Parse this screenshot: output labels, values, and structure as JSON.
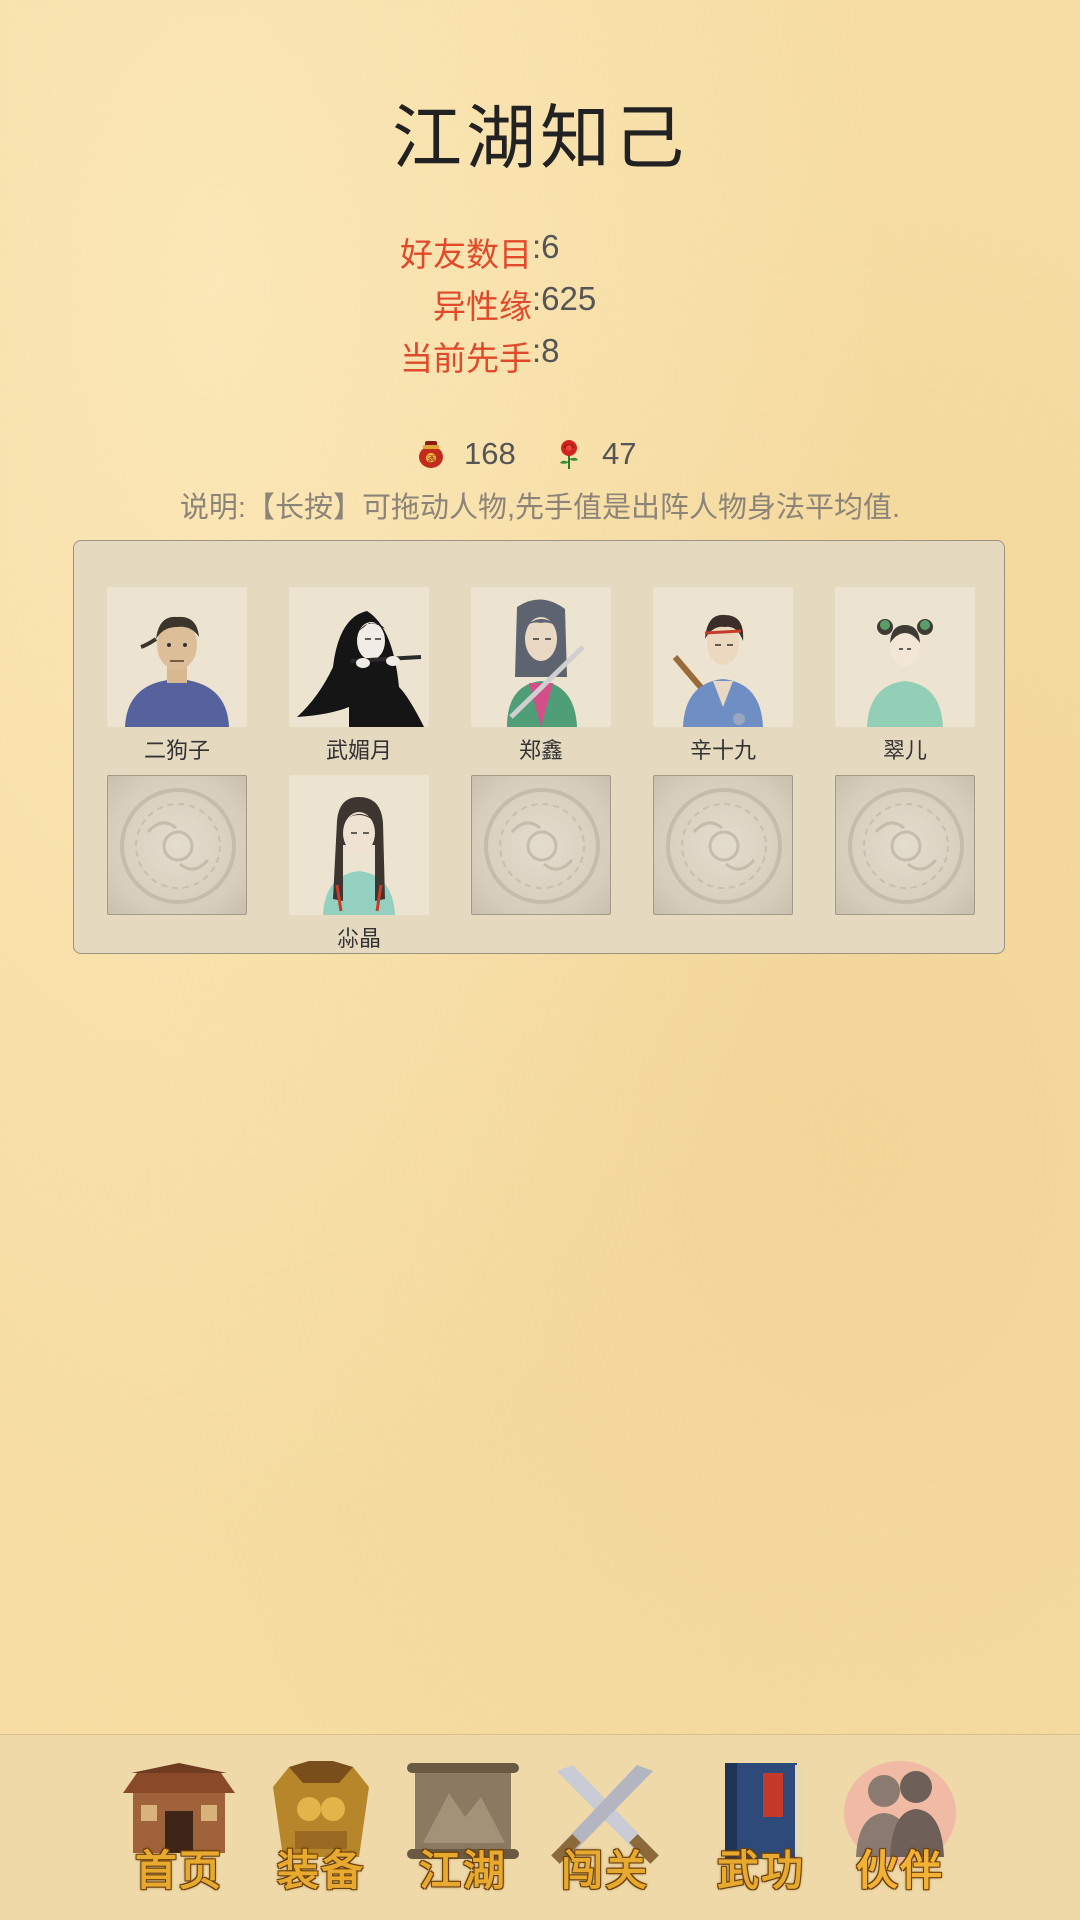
{
  "page": {
    "title": "江湖知己"
  },
  "stats": [
    {
      "label": "好友数目",
      "value": ":6"
    },
    {
      "label": "异性缘",
      "value": ":625"
    },
    {
      "label": "当前先手",
      "value": ":8"
    }
  ],
  "currency": [
    {
      "icon": "wine-jar-icon",
      "value": "168"
    },
    {
      "icon": "rose-icon",
      "value": "47"
    }
  ],
  "note": "说明:【长按】可拖动人物,先手值是出阵人物身法平均值.",
  "party": {
    "row1": [
      {
        "name": "二狗子",
        "portrait": "man-blue-robe"
      },
      {
        "name": "武媚月",
        "portrait": "woman-black-flute"
      },
      {
        "name": "郑鑫",
        "portrait": "swordsman-green-robe"
      },
      {
        "name": "辛十九",
        "portrait": "youth-blue-staff"
      },
      {
        "name": "翠儿",
        "portrait": "girl-teal-dress"
      }
    ],
    "row2": [
      {
        "name": "",
        "portrait": "empty"
      },
      {
        "name": "尛晶",
        "portrait": "woman-braids-teal"
      },
      {
        "name": "",
        "portrait": "empty"
      },
      {
        "name": "",
        "portrait": "empty"
      },
      {
        "name": "",
        "portrait": "empty"
      }
    ]
  },
  "nav": {
    "active": "伙伴",
    "items": [
      {
        "label": "首页",
        "icon": "house-icon"
      },
      {
        "label": "装备",
        "icon": "armor-icon"
      },
      {
        "label": "江湖",
        "icon": "scroll-map-icon"
      },
      {
        "label": "闯关",
        "icon": "crossed-swords-icon"
      },
      {
        "label": "武功",
        "icon": "martial-book-icon"
      },
      {
        "label": "伙伴",
        "icon": "companions-icon"
      }
    ]
  }
}
